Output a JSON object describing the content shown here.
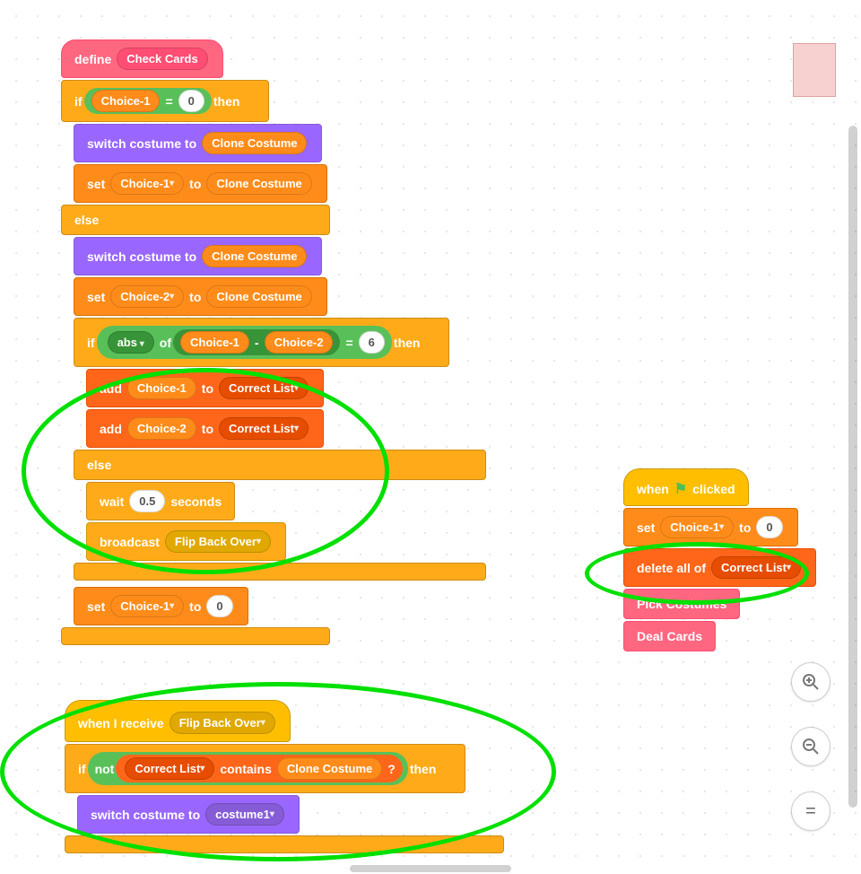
{
  "define": {
    "label": "define",
    "proc": "Check Cards"
  },
  "if1": {
    "if": "if",
    "then": "then",
    "else": "else",
    "var": "Choice-1",
    "eq": "=",
    "val": "0"
  },
  "switch1": {
    "label": "switch costume to",
    "val": "Clone Costume"
  },
  "set1": {
    "label": "set",
    "var": "Choice-1",
    "to": "to",
    "val": "Clone Costume"
  },
  "switch2": {
    "label": "switch costume to",
    "val": "Clone Costume"
  },
  "set2": {
    "label": "set",
    "var": "Choice-2",
    "to": "to",
    "val": "Clone Costume"
  },
  "if2": {
    "if": "if",
    "then": "then",
    "else": "else",
    "abs": "abs",
    "of": "of",
    "c1": "Choice-1",
    "minus": "-",
    "c2": "Choice-2",
    "eq": "=",
    "val": "6"
  },
  "add1": {
    "label": "add",
    "var": "Choice-1",
    "to": "to",
    "list": "Correct List"
  },
  "add2": {
    "label": "add",
    "var": "Choice-2",
    "to": "to",
    "list": "Correct List"
  },
  "wait": {
    "label": "wait",
    "val": "0.5",
    "sec": "seconds"
  },
  "broadcast": {
    "label": "broadcast",
    "msg": "Flip Back Over"
  },
  "set3": {
    "label": "set",
    "var": "Choice-1",
    "to": "to",
    "val": "0"
  },
  "hat2": {
    "label": "when I receive",
    "msg": "Flip Back Over"
  },
  "if3": {
    "if": "if",
    "not": "not",
    "list": "Correct List",
    "contains": "contains",
    "cc": "Clone Costume",
    "q": "?",
    "then": "then"
  },
  "switch3": {
    "label": "switch costume to",
    "val": "costume1"
  },
  "flaghat": {
    "when": "when",
    "clicked": "clicked"
  },
  "setA": {
    "label": "set",
    "var": "Choice-1",
    "to": "to",
    "val": "0"
  },
  "delall": {
    "label": "delete all of",
    "list": "Correct List"
  },
  "proc1": "Pick Costumes",
  "proc2": "Deal Cards",
  "zoom": {
    "in": "+",
    "out": "−",
    "eq": "="
  }
}
